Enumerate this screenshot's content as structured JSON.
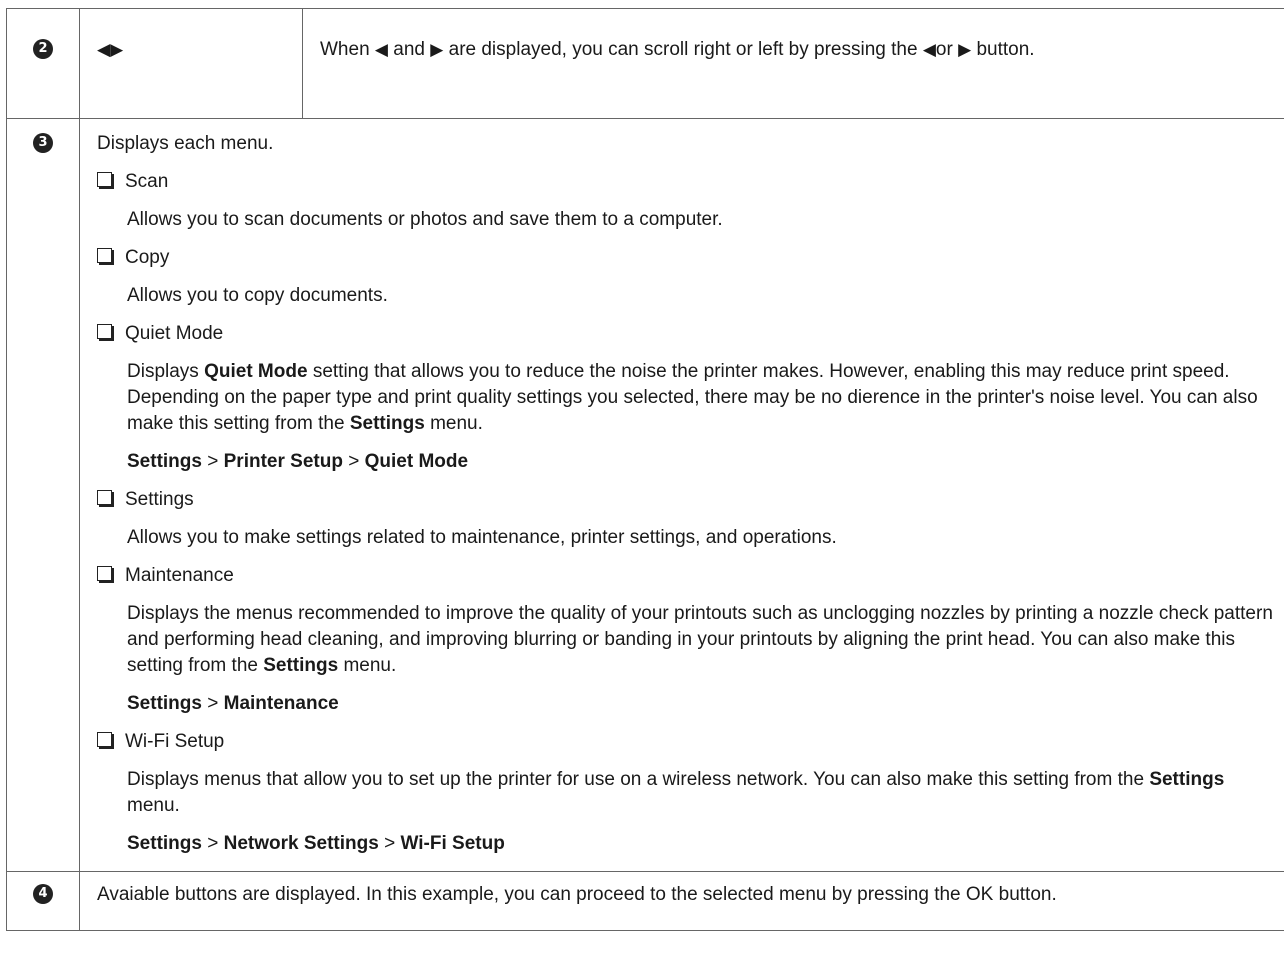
{
  "row2": {
    "marker": "❷",
    "arrows": "◀▶",
    "desc_pre": "When",
    "left_glyph": "◀",
    "and": "and",
    "right_glyph": "▶",
    "desc_mid": "are displayed, you can scroll right or left by pressing the",
    "or": "or",
    "desc_post": "button."
  },
  "row3": {
    "marker": "❸",
    "intro": "Displays each menu.",
    "items": [
      {
        "title": "Scan",
        "body": "Allows you to scan documents or photos and save them to a computer."
      },
      {
        "title": "Copy",
        "body": "Allows you to copy documents."
      },
      {
        "title": "Quiet Mode",
        "body_pre": "Displays",
        "body_bold": "Quiet Mode",
        "body_mid": "setting that allows you to reduce the noise the printer makes. However, enabling this may reduce print speed. Depending on the paper type and print quality settings you selected, there may be no dierence in the printer's noise level. You can also make this setting from the",
        "body_bold2": "Settings",
        "body_post": "menu.",
        "path": [
          "Settings",
          "Printer Setup",
          "Quiet Mode"
        ]
      },
      {
        "title": "Settings",
        "body": "Allows you to make settings related to maintenance, printer settings, and operations."
      },
      {
        "title": "Maintenance",
        "body_pre": "Displays the menus recommended to improve the quality of your printouts such as unclogging nozzles by printing a nozzle check pattern and performing head cleaning, and improving blurring or banding in your printouts by aligning the print head. You can also make this setting from the",
        "body_bold": "Settings",
        "body_post": "menu.",
        "path": [
          "Settings",
          "Maintenance"
        ]
      },
      {
        "title": "Wi-Fi Setup",
        "body_pre": "Displays menus that allow you to set up the printer for use on a wireless network. You can also make this setting from the",
        "body_bold": "Settings",
        "body_post": "menu.",
        "path": [
          "Settings",
          "Network Settings",
          "Wi-Fi Setup"
        ]
      }
    ]
  },
  "row4": {
    "marker": "❹",
    "text": "Avaiable buttons are displayed. In this example, you can proceed to the selected menu by pressing the OK button."
  },
  "separator": ">"
}
